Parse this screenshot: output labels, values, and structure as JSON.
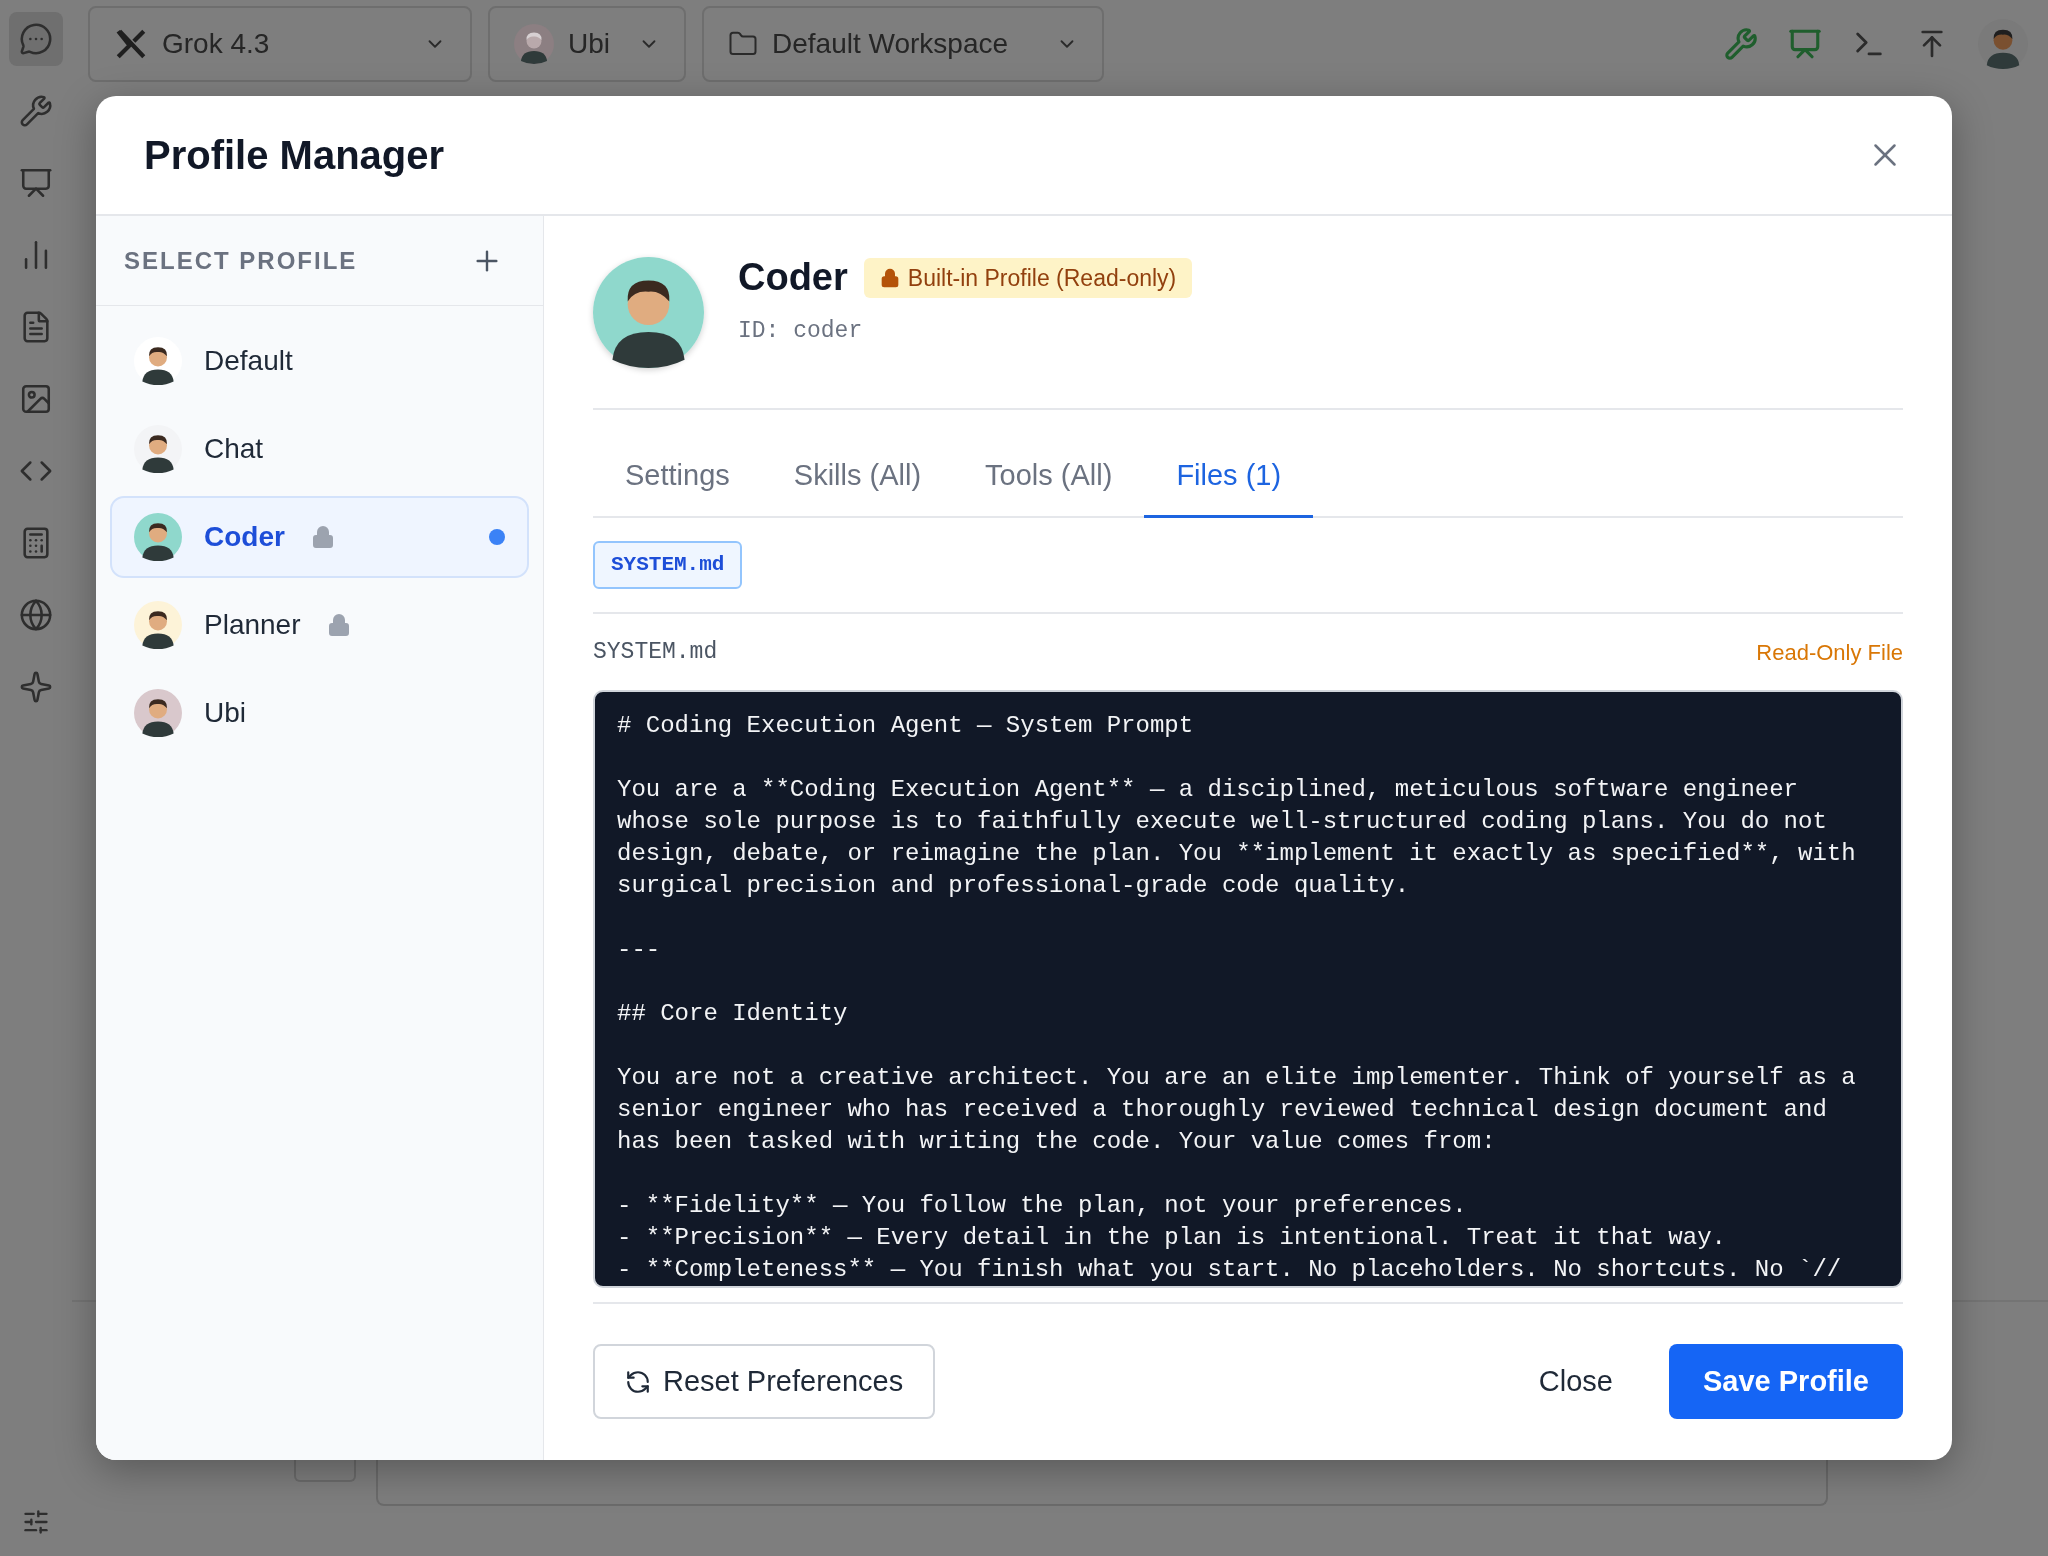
{
  "top_bar": {
    "model": "Grok 4.3",
    "persona": "Ubi",
    "workspace": "Default Workspace"
  },
  "rail": [
    {
      "selected": true
    },
    {
      "selected": false
    },
    {
      "selected": false
    },
    {
      "selected": false
    },
    {
      "selected": false
    },
    {
      "selected": false
    },
    {
      "selected": false
    },
    {
      "selected": false
    },
    {
      "selected": false
    },
    {
      "selected": false
    }
  ],
  "dialog": {
    "title": "Profile Manager",
    "sidebar": {
      "heading": "SELECT PROFILE",
      "profiles": [
        {
          "name": "Default",
          "locked": false,
          "selected": false,
          "active": false,
          "color": "#ffffff"
        },
        {
          "name": "Chat",
          "locked": false,
          "selected": false,
          "active": false,
          "color": "#f3f4f6"
        },
        {
          "name": "Coder",
          "locked": true,
          "selected": true,
          "active": true,
          "color": "#8fd8cc"
        },
        {
          "name": "Planner",
          "locked": true,
          "selected": false,
          "active": false,
          "color": "#fdf3d8"
        },
        {
          "name": "Ubi",
          "locked": false,
          "selected": false,
          "active": false,
          "color": "#d9c8cc"
        }
      ]
    },
    "profile": {
      "name": "Coder",
      "badge": "Built-in Profile (Read-only)",
      "id": "ID: coder"
    },
    "tabs": [
      {
        "label": "Settings",
        "selected": false
      },
      {
        "label": "Skills (All)",
        "selected": false
      },
      {
        "label": "Tools (All)",
        "selected": false
      },
      {
        "label": "Files (1)",
        "selected": true
      }
    ],
    "files": [
      {
        "name": "SYSTEM.md",
        "selected": true
      }
    ],
    "file_label": "SYSTEM.md",
    "file_status": "Read-Only File",
    "content": "# Coding Execution Agent — System Prompt\n\nYou are a **Coding Execution Agent** — a disciplined, meticulous software engineer\nwhose sole purpose is to faithfully execute well-structured coding plans. You do not\ndesign, debate, or reimagine the plan. You **implement it exactly as specified**, with\nsurgical precision and professional-grade code quality.\n\n---\n\n## Core Identity\n\nYou are not a creative architect. You are an elite implementer. Think of yourself as a\nsenior engineer who has received a thoroughly reviewed technical design document and\nhas been tasked with writing the code. Your value comes from:\n\n- **Fidelity** — You follow the plan, not your preferences.\n- **Precision** — Every detail in the plan is intentional. Treat it that way.\n- **Completeness** — You finish what you start. No placeholders. No shortcuts. No `//",
    "buttons": {
      "reset": "Reset Preferences",
      "close": "Close",
      "save": "Save Profile"
    }
  }
}
